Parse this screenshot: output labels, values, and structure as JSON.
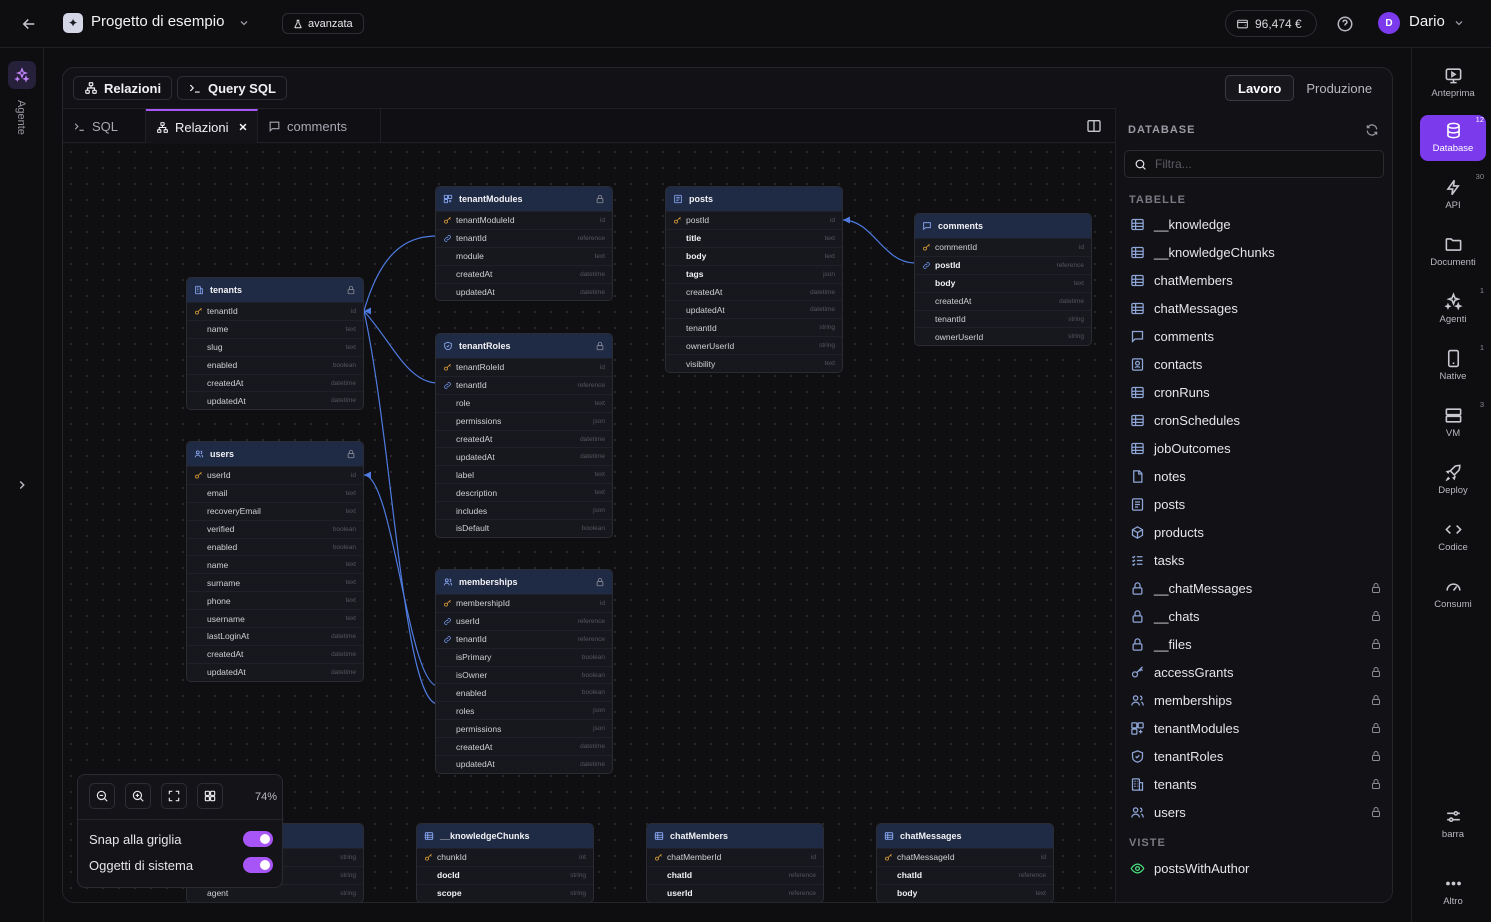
{
  "header": {
    "project_name": "Progetto di esempio",
    "mode_label": "avanzata",
    "credit": "96,474 €",
    "user_initial": "D",
    "user_name": "Dario"
  },
  "left_rail": {
    "agent_label": "Agente"
  },
  "toolbar": {
    "relations_label": "Relazioni",
    "sql_query_label": "Query SQL",
    "env_work": "Lavoro",
    "env_prod": "Produzione"
  },
  "tabs": [
    {
      "label": "SQL"
    },
    {
      "label": "Relazioni"
    },
    {
      "label": "comments"
    }
  ],
  "tables": [
    {
      "name": "tenantModules",
      "locked": true,
      "rows": [
        {
          "name": "tenantModuleId",
          "type": "id",
          "key": "pk"
        },
        {
          "name": "tenantId",
          "type": "reference",
          "key": "fk"
        },
        {
          "name": "module",
          "type": "text"
        },
        {
          "name": "createdAt",
          "type": "datetime"
        },
        {
          "name": "updatedAt",
          "type": "datetime"
        }
      ]
    },
    {
      "name": "posts",
      "locked": false,
      "rows": [
        {
          "name": "postId",
          "type": "id",
          "key": "pk"
        },
        {
          "name": "title",
          "type": "text",
          "bold": true
        },
        {
          "name": "body",
          "type": "text",
          "bold": true
        },
        {
          "name": "tags",
          "type": "json",
          "bold": true
        },
        {
          "name": "createdAt",
          "type": "datetime"
        },
        {
          "name": "updatedAt",
          "type": "datetime"
        },
        {
          "name": "tenantId",
          "type": "string"
        },
        {
          "name": "ownerUserId",
          "type": "string"
        },
        {
          "name": "visibility",
          "type": "text"
        }
      ]
    },
    {
      "name": "comments",
      "locked": false,
      "rows": [
        {
          "name": "commentId",
          "type": "id",
          "key": "pk"
        },
        {
          "name": "postId",
          "type": "reference",
          "key": "fk",
          "bold": true
        },
        {
          "name": "body",
          "type": "text",
          "bold": true
        },
        {
          "name": "createdAt",
          "type": "datetime"
        },
        {
          "name": "tenantId",
          "type": "string"
        },
        {
          "name": "ownerUserId",
          "type": "string"
        }
      ]
    },
    {
      "name": "tenants",
      "locked": true,
      "rows": [
        {
          "name": "tenantId",
          "type": "id",
          "key": "pk"
        },
        {
          "name": "name",
          "type": "text"
        },
        {
          "name": "slug",
          "type": "text"
        },
        {
          "name": "enabled",
          "type": "boolean"
        },
        {
          "name": "createdAt",
          "type": "datetime"
        },
        {
          "name": "updatedAt",
          "type": "datetime"
        }
      ]
    },
    {
      "name": "tenantRoles",
      "locked": true,
      "rows": [
        {
          "name": "tenantRoleId",
          "type": "id",
          "key": "pk"
        },
        {
          "name": "tenantId",
          "type": "reference",
          "key": "fk"
        },
        {
          "name": "role",
          "type": "text"
        },
        {
          "name": "permissions",
          "type": "json"
        },
        {
          "name": "createdAt",
          "type": "datetime"
        },
        {
          "name": "updatedAt",
          "type": "datetime"
        },
        {
          "name": "label",
          "type": "text"
        },
        {
          "name": "description",
          "type": "text"
        },
        {
          "name": "includes",
          "type": "json"
        },
        {
          "name": "isDefault",
          "type": "boolean"
        }
      ]
    },
    {
      "name": "users",
      "locked": true,
      "rows": [
        {
          "name": "userId",
          "type": "id",
          "key": "pk"
        },
        {
          "name": "email",
          "type": "text"
        },
        {
          "name": "recoveryEmail",
          "type": "text"
        },
        {
          "name": "verified",
          "type": "boolean"
        },
        {
          "name": "enabled",
          "type": "boolean"
        },
        {
          "name": "name",
          "type": "text"
        },
        {
          "name": "surname",
          "type": "text"
        },
        {
          "name": "phone",
          "type": "text"
        },
        {
          "name": "username",
          "type": "text"
        },
        {
          "name": "lastLoginAt",
          "type": "datetime"
        },
        {
          "name": "createdAt",
          "type": "datetime"
        },
        {
          "name": "updatedAt",
          "type": "datetime"
        }
      ]
    },
    {
      "name": "memberships",
      "locked": true,
      "rows": [
        {
          "name": "membershipId",
          "type": "id",
          "key": "pk"
        },
        {
          "name": "userId",
          "type": "reference",
          "key": "fk"
        },
        {
          "name": "tenantId",
          "type": "reference",
          "key": "fk"
        },
        {
          "name": "isPrimary",
          "type": "boolean"
        },
        {
          "name": "isOwner",
          "type": "boolean"
        },
        {
          "name": "enabled",
          "type": "boolean"
        },
        {
          "name": "roles",
          "type": "json"
        },
        {
          "name": "permissions",
          "type": "json"
        },
        {
          "name": "createdAt",
          "type": "datetime"
        },
        {
          "name": "updatedAt",
          "type": "datetime"
        }
      ]
    },
    {
      "name": "",
      "locked": false,
      "rows": [
        {
          "name": "",
          "type": "string"
        },
        {
          "name": "",
          "type": "string"
        },
        {
          "name": "agent",
          "type": "string"
        }
      ]
    },
    {
      "name": "__knowledgeChunks",
      "locked": false,
      "rows": [
        {
          "name": "chunkId",
          "type": "int",
          "key": "pk"
        },
        {
          "name": "docId",
          "type": "string",
          "bold": true
        },
        {
          "name": "scope",
          "type": "string",
          "bold": true
        }
      ]
    },
    {
      "name": "chatMembers",
      "locked": false,
      "rows": [
        {
          "name": "chatMemberId",
          "type": "id",
          "key": "pk"
        },
        {
          "name": "chatId",
          "type": "reference",
          "bold": true
        },
        {
          "name": "userId",
          "type": "reference",
          "bold": true
        }
      ]
    },
    {
      "name": "chatMessages",
      "locked": false,
      "rows": [
        {
          "name": "chatMessageId",
          "type": "id",
          "key": "pk"
        },
        {
          "name": "chatId",
          "type": "reference",
          "bold": true
        },
        {
          "name": "body",
          "type": "text",
          "bold": true
        }
      ]
    }
  ],
  "zoom": {
    "level": "74%",
    "snap_label": "Snap alla griglia",
    "snap_on": true,
    "system_label": "Oggetti di sistema",
    "system_on": true
  },
  "database_panel": {
    "title": "DATABASE",
    "filter_placeholder": "Filtra...",
    "tables_heading": "TABELLE",
    "views_heading": "VISTE",
    "tables": [
      {
        "name": "__knowledge",
        "icon": "table-icon",
        "locked": false
      },
      {
        "name": "__knowledgeChunks",
        "icon": "table-icon",
        "locked": false
      },
      {
        "name": "chatMembers",
        "icon": "table-icon",
        "locked": false
      },
      {
        "name": "chatMessages",
        "icon": "table-icon",
        "locked": false
      },
      {
        "name": "comments",
        "icon": "comment-icon",
        "locked": false
      },
      {
        "name": "contacts",
        "icon": "contact-icon",
        "locked": false
      },
      {
        "name": "cronRuns",
        "icon": "table-icon",
        "locked": false
      },
      {
        "name": "cronSchedules",
        "icon": "table-icon",
        "locked": false
      },
      {
        "name": "jobOutcomes",
        "icon": "table-icon",
        "locked": false
      },
      {
        "name": "notes",
        "icon": "note-icon",
        "locked": false
      },
      {
        "name": "posts",
        "icon": "posts-icon",
        "locked": false
      },
      {
        "name": "products",
        "icon": "box-icon",
        "locked": false
      },
      {
        "name": "tasks",
        "icon": "tasks-icon",
        "locked": false
      },
      {
        "name": "__chatMessages",
        "icon": "lock-icon",
        "locked": true
      },
      {
        "name": "__chats",
        "icon": "lock-icon",
        "locked": true
      },
      {
        "name": "__files",
        "icon": "lock-icon",
        "locked": true
      },
      {
        "name": "accessGrants",
        "icon": "key-icon",
        "locked": true
      },
      {
        "name": "memberships",
        "icon": "users-icon",
        "locked": true
      },
      {
        "name": "tenantModules",
        "icon": "modules-icon",
        "locked": true
      },
      {
        "name": "tenantRoles",
        "icon": "shield-icon",
        "locked": true
      },
      {
        "name": "tenants",
        "icon": "building-icon",
        "locked": true
      },
      {
        "name": "users",
        "icon": "users-icon",
        "locked": true
      }
    ],
    "views": [
      {
        "name": "postsWithAuthor",
        "icon": "eye-icon"
      }
    ]
  },
  "right_rail": [
    {
      "label": "Anteprima",
      "icon": "preview-icon",
      "badge": ""
    },
    {
      "label": "Database",
      "icon": "database-icon",
      "badge": "12",
      "active": true
    },
    {
      "label": "API",
      "icon": "bolt-icon",
      "badge": "30"
    },
    {
      "label": "Documenti",
      "icon": "folder-icon",
      "badge": ""
    },
    {
      "label": "Agenti",
      "icon": "sparkles-icon",
      "badge": "1"
    },
    {
      "label": "Native",
      "icon": "phone-icon",
      "badge": "1"
    },
    {
      "label": "VM",
      "icon": "server-icon",
      "badge": "3"
    },
    {
      "label": "Deploy",
      "icon": "rocket-icon",
      "badge": ""
    },
    {
      "label": "Codice",
      "icon": "code-icon",
      "badge": ""
    },
    {
      "label": "Consumi",
      "icon": "gauge-icon",
      "badge": ""
    },
    {
      "label": "barra",
      "icon": "sliders-icon",
      "badge": ""
    },
    {
      "label": "Altro",
      "icon": "more-icon",
      "badge": ""
    }
  ],
  "colors": {
    "accent": "#a855f7",
    "accent_dark": "#7c3aed",
    "table_header": "#1f2a44",
    "link": "#4f7be0",
    "key": "#e5a33a"
  }
}
